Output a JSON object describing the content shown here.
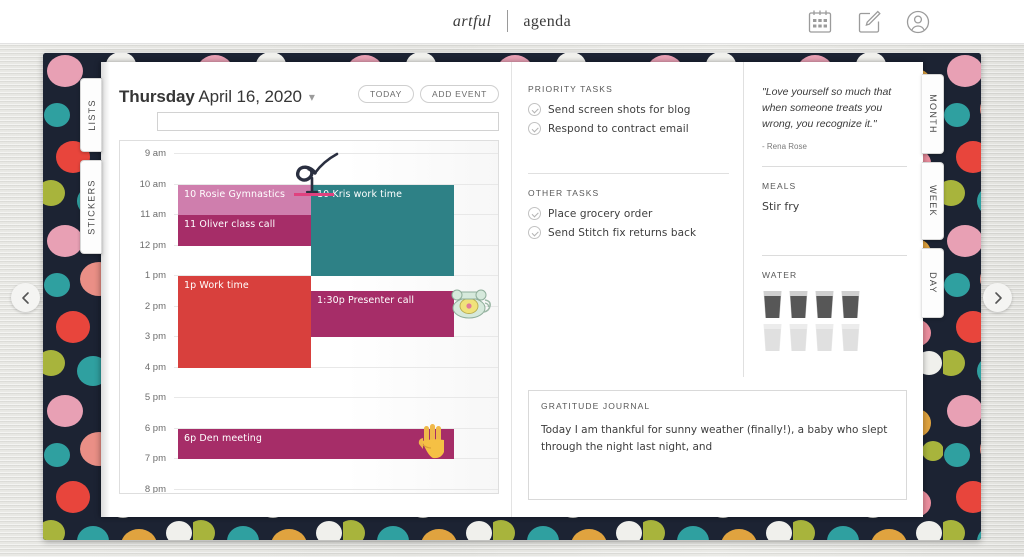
{
  "header": {
    "logo_primary": "artful",
    "logo_secondary": "agenda",
    "icons": [
      "calendar-icon",
      "edit-icon",
      "account-icon"
    ]
  },
  "nav": {
    "prev_label": "‹",
    "next_label": "›"
  },
  "tabs": {
    "left": [
      {
        "label": "LISTS"
      },
      {
        "label": "STICKERS"
      }
    ],
    "right": [
      {
        "label": "MONTH"
      },
      {
        "label": "WEEK"
      },
      {
        "label": "DAY"
      }
    ]
  },
  "left_page": {
    "day_of_week": "Thursday",
    "date": "April 16, 2020",
    "caret": "⌄",
    "buttons": {
      "today": "TODAY",
      "add_event": "ADD EVENT"
    },
    "note_input_value": "",
    "note_input_placeholder": "",
    "hours": [
      "9 am",
      "10 am",
      "11 am",
      "12 pm",
      "1 pm",
      "2 pm",
      "3 pm",
      "4 pm",
      "5 pm",
      "6 pm",
      "7 pm",
      "8 pm"
    ],
    "events": [
      {
        "label": "10 Rosie Gymnastics",
        "color": "#cf7ead",
        "start_hour": 10.0,
        "end_hour": 11.0,
        "column": "left"
      },
      {
        "label": "11 Oliver class call",
        "color": "#a62d68",
        "start_hour": 11.0,
        "end_hour": 12.0,
        "column": "left"
      },
      {
        "label": "10 Kris work time",
        "color": "#2e8186",
        "start_hour": 10.0,
        "end_hour": 13.0,
        "column": "right"
      },
      {
        "label": "1p Work time",
        "color": "#d8403d",
        "start_hour": 13.0,
        "end_hour": 16.0,
        "column": "left"
      },
      {
        "label": "1:30p Presenter call",
        "color": "#a62d68",
        "start_hour": 13.5,
        "end_hour": 15.0,
        "column": "right"
      },
      {
        "label": "6p Den meeting",
        "color": "#a62d68",
        "start_hour": 18.0,
        "end_hour": 19.0,
        "column": "full"
      }
    ],
    "stickers": [
      {
        "name": "gymnast-sticker"
      },
      {
        "name": "telephone-sticker"
      },
      {
        "name": "hand-sticker"
      }
    ]
  },
  "right_page": {
    "priority_tasks_heading": "PRIORITY TASKS",
    "priority_tasks": [
      {
        "text": "Send screen shots for blog",
        "checked": true
      },
      {
        "text": "Respond to contract email",
        "checked": true
      }
    ],
    "other_tasks_heading": "OTHER TASKS",
    "other_tasks": [
      {
        "text": "Place grocery order",
        "checked": true
      },
      {
        "text": "Send Stitch fix returns back",
        "checked": true
      }
    ],
    "quote_text": "\"Love yourself so much that when someone treats you wrong, you recognize it.\"",
    "quote_author": "- Rena Rose",
    "meals_heading": "MEALS",
    "meals_text": "Stir fry",
    "water_heading": "WATER",
    "water_filled": 4,
    "water_total": 8,
    "gratitude_heading": "GRATITUDE JOURNAL",
    "gratitude_text": "Today I am thankful for sunny weather (finally!), a baby who slept through the night last night, and"
  },
  "colors": {
    "cover": "#1c2333",
    "pink": "#cf7ead",
    "magenta": "#a62d68",
    "teal": "#2e8186",
    "red": "#d8403d"
  }
}
